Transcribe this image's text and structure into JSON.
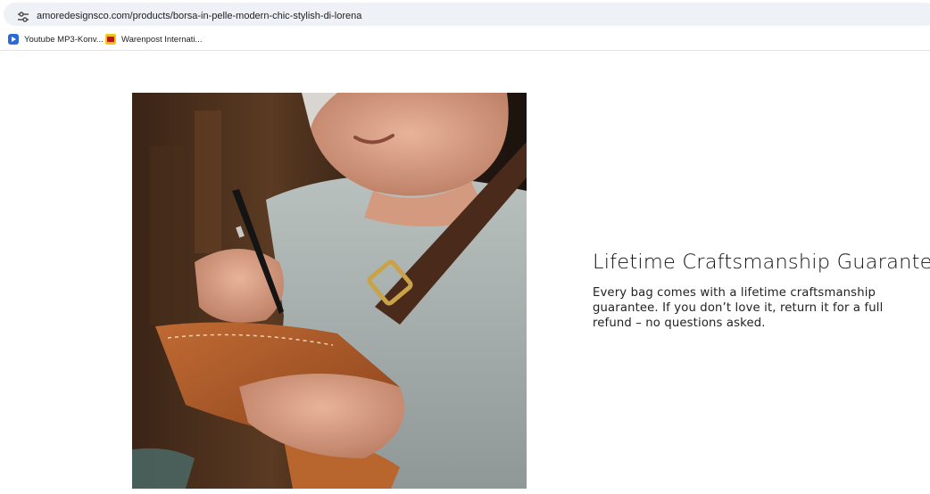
{
  "browser": {
    "url": "amoredesignsco.com/products/borsa-in-pelle-modern-chic-stylish-di-lorena",
    "bookmarks": [
      {
        "label": "Youtube MP3-Konv...",
        "icon": "youtube-icon"
      },
      {
        "label": "Warenpost Internati...",
        "icon": "dhl-icon"
      }
    ]
  },
  "feature": {
    "title": "Lifetime Craftsmanship Guarantee",
    "body": "Every bag comes with a lifetime craftsmanship guarantee. If you don’t love it, return it for a full refund – no questions asked."
  },
  "image": {
    "subject": "hero-photo"
  }
}
